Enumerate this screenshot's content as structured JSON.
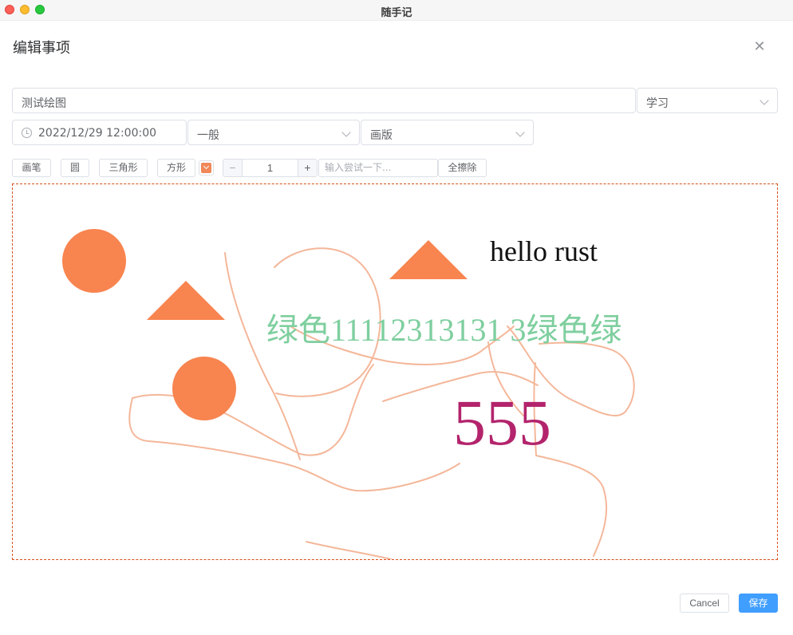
{
  "window": {
    "title": "随手记"
  },
  "dialog": {
    "title": "编辑事项",
    "close_icon": "close-icon"
  },
  "form": {
    "title_value": "测试绘图",
    "category_value": "学习",
    "datetime_value": "2022/12/29 12:00:00",
    "level_value": "一般",
    "type_value": "画版"
  },
  "toolbar": {
    "pen_label": "画笔",
    "circle_label": "圆",
    "triangle_label": "三角形",
    "rect_label": "方形",
    "color_value": "#f0885a",
    "stroke_width": "1",
    "minus_label": "−",
    "plus_label": "+",
    "text_placeholder": "输入尝试一下...",
    "clear_label": "全擦除"
  },
  "canvas": {
    "texts": {
      "hello": "hello rust",
      "green": "绿色11112313131 3绿色绿",
      "number": "555"
    },
    "colors": {
      "shape": "#f8844f",
      "stroke": "#f4b79a",
      "green_text": "#7fcf9f",
      "number_text": "#b3246c",
      "border": "#d9501c"
    }
  },
  "footer": {
    "cancel_label": "Cancel",
    "save_label": "保存"
  }
}
